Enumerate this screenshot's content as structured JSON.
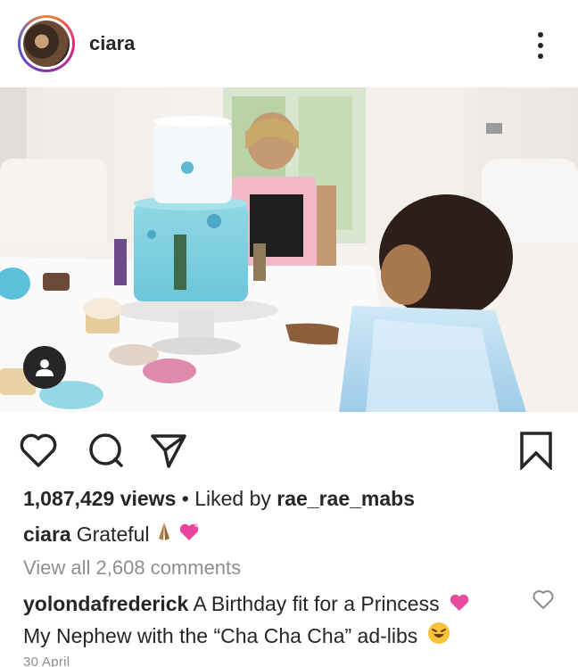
{
  "post": {
    "username": "ciara",
    "views_count": "1,087,429 views",
    "separator": "•",
    "liked_by_prefix": "Liked by",
    "liked_by_user": "rae_rae_mabs",
    "caption_user": "ciara",
    "caption_text": "Grateful",
    "view_all_comments": "View all 2,608 comments",
    "comment": {
      "user": "yolondafrederick",
      "line1": "A Birthday fit for a Princess",
      "line2": "My Nephew with the “Cha Cha Cha” ad-libs"
    },
    "date": "30 April"
  },
  "icons": {
    "more": "more-options-icon",
    "like": "heart-icon",
    "comment": "comment-icon",
    "share": "send-icon",
    "save": "bookmark-icon",
    "tag": "user-tag-icon",
    "comment_like": "small-heart-icon"
  },
  "colors": {
    "text": "#262626",
    "secondary": "#8e8e8e",
    "ring_start": "#f58529",
    "ring_end": "#515bd4"
  }
}
